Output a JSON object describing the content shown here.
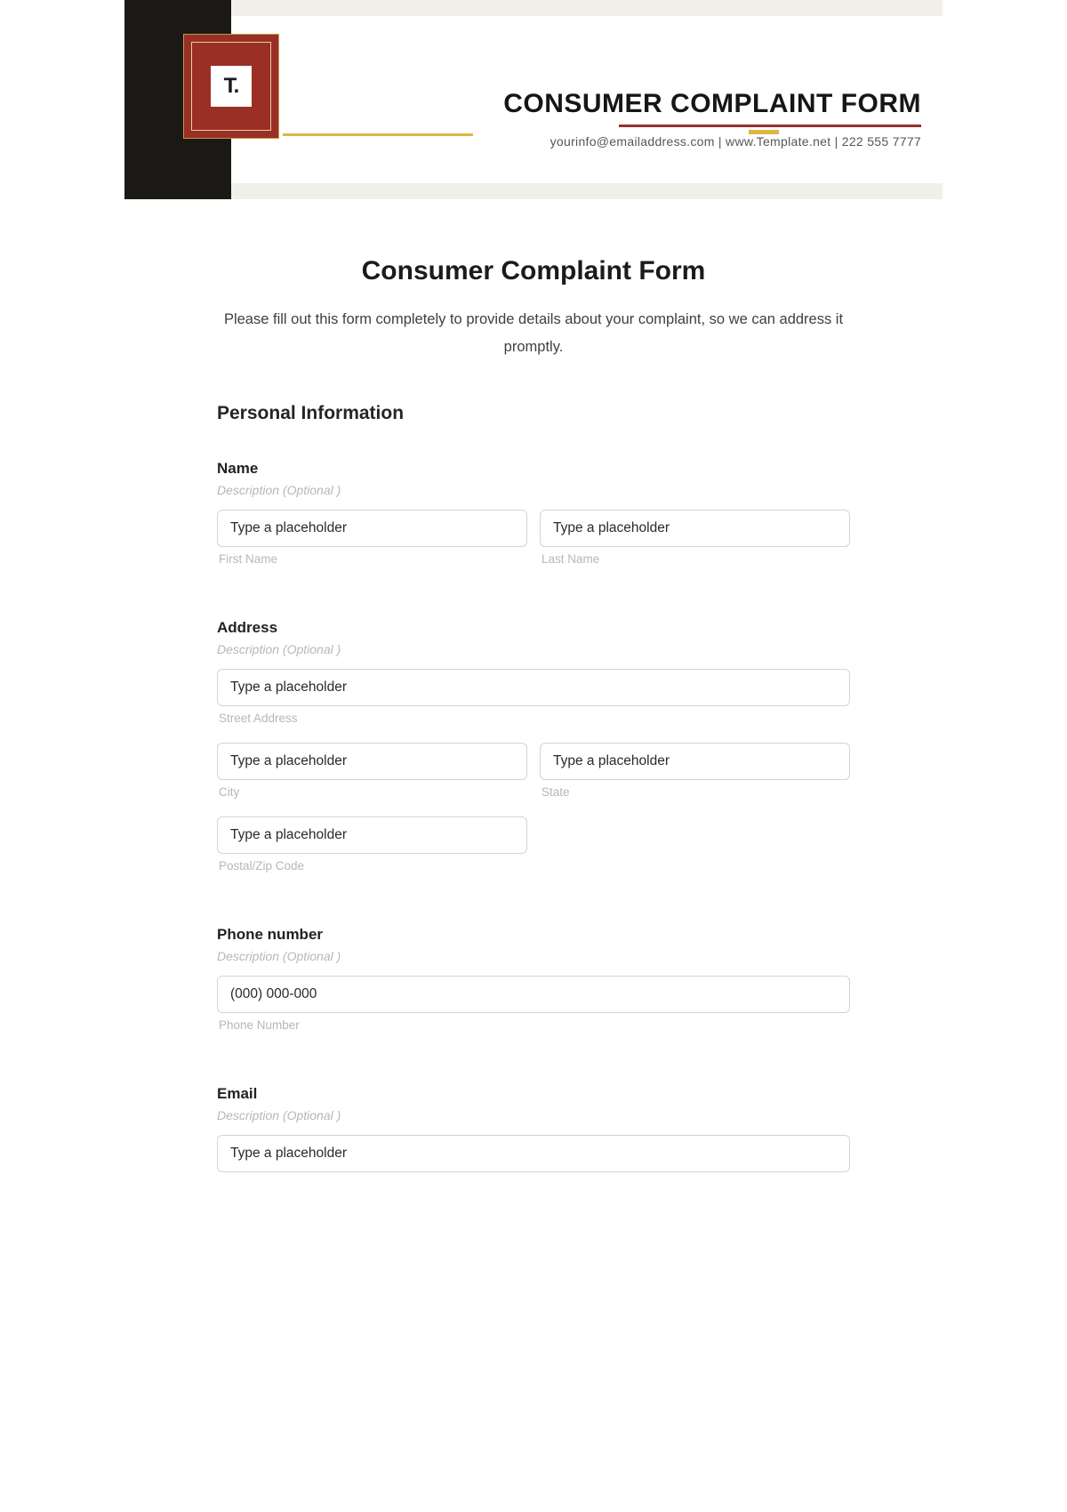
{
  "header": {
    "logo_letter": "T.",
    "title": "CONSUMER COMPLAINT FORM",
    "contact_line": "yourinfo@emailaddress.com  |  www.Template.net  |  222 555 7777"
  },
  "form": {
    "title": "Consumer Complaint Form",
    "intro": "Please fill out this form completely to provide details about your complaint, so we can address it promptly.",
    "section_personal": "Personal Information",
    "name": {
      "label": "Name",
      "desc": "Description  (Optional )",
      "first_placeholder": "Type a placeholder",
      "first_sublabel": "First Name",
      "last_placeholder": "Type a placeholder",
      "last_sublabel": "Last Name"
    },
    "address": {
      "label": "Address",
      "desc": "Description  (Optional )",
      "street_placeholder": "Type a placeholder",
      "street_sublabel": "Street Address",
      "city_placeholder": "Type a placeholder",
      "city_sublabel": "City",
      "state_placeholder": "Type a placeholder",
      "state_sublabel": "State",
      "zip_placeholder": "Type a placeholder",
      "zip_sublabel": "Postal/Zip Code"
    },
    "phone": {
      "label": "Phone number",
      "desc": "Description  (Optional )",
      "placeholder": "(000) 000-000",
      "sublabel": "Phone Number"
    },
    "email": {
      "label": "Email",
      "desc": "Description  (Optional )",
      "placeholder": "Type a placeholder"
    }
  }
}
